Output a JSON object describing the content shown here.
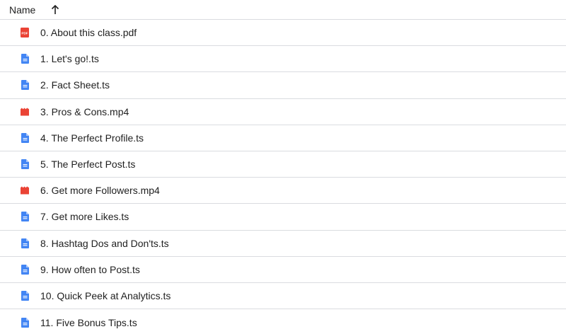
{
  "header": {
    "column_label": "Name",
    "sort_icon": "arrow-up-icon"
  },
  "files": [
    {
      "name": "0. About this class.pdf",
      "icon": "pdf-icon",
      "icon_color": "#ea4335"
    },
    {
      "name": "1. Let's go!.ts",
      "icon": "document-icon",
      "icon_color": "#4285f4"
    },
    {
      "name": "2. Fact Sheet.ts",
      "icon": "document-icon",
      "icon_color": "#4285f4"
    },
    {
      "name": "3. Pros & Cons.mp4",
      "icon": "video-icon",
      "icon_color": "#ea4335"
    },
    {
      "name": "4. The Perfect Profile.ts",
      "icon": "document-icon",
      "icon_color": "#4285f4"
    },
    {
      "name": "5. The Perfect Post.ts",
      "icon": "document-icon",
      "icon_color": "#4285f4"
    },
    {
      "name": "6. Get more Followers.mp4",
      "icon": "video-icon",
      "icon_color": "#ea4335"
    },
    {
      "name": "7. Get more Likes.ts",
      "icon": "document-icon",
      "icon_color": "#4285f4"
    },
    {
      "name": "8. Hashtag Dos and Don'ts.ts",
      "icon": "document-icon",
      "icon_color": "#4285f4"
    },
    {
      "name": "9. How often to Post.ts",
      "icon": "document-icon",
      "icon_color": "#4285f4"
    },
    {
      "name": "10. Quick Peek at Analytics.ts",
      "icon": "document-icon",
      "icon_color": "#4285f4"
    },
    {
      "name": "11. Five Bonus Tips.ts",
      "icon": "document-icon",
      "icon_color": "#4285f4"
    }
  ],
  "pdf_icon_text": "PDF"
}
